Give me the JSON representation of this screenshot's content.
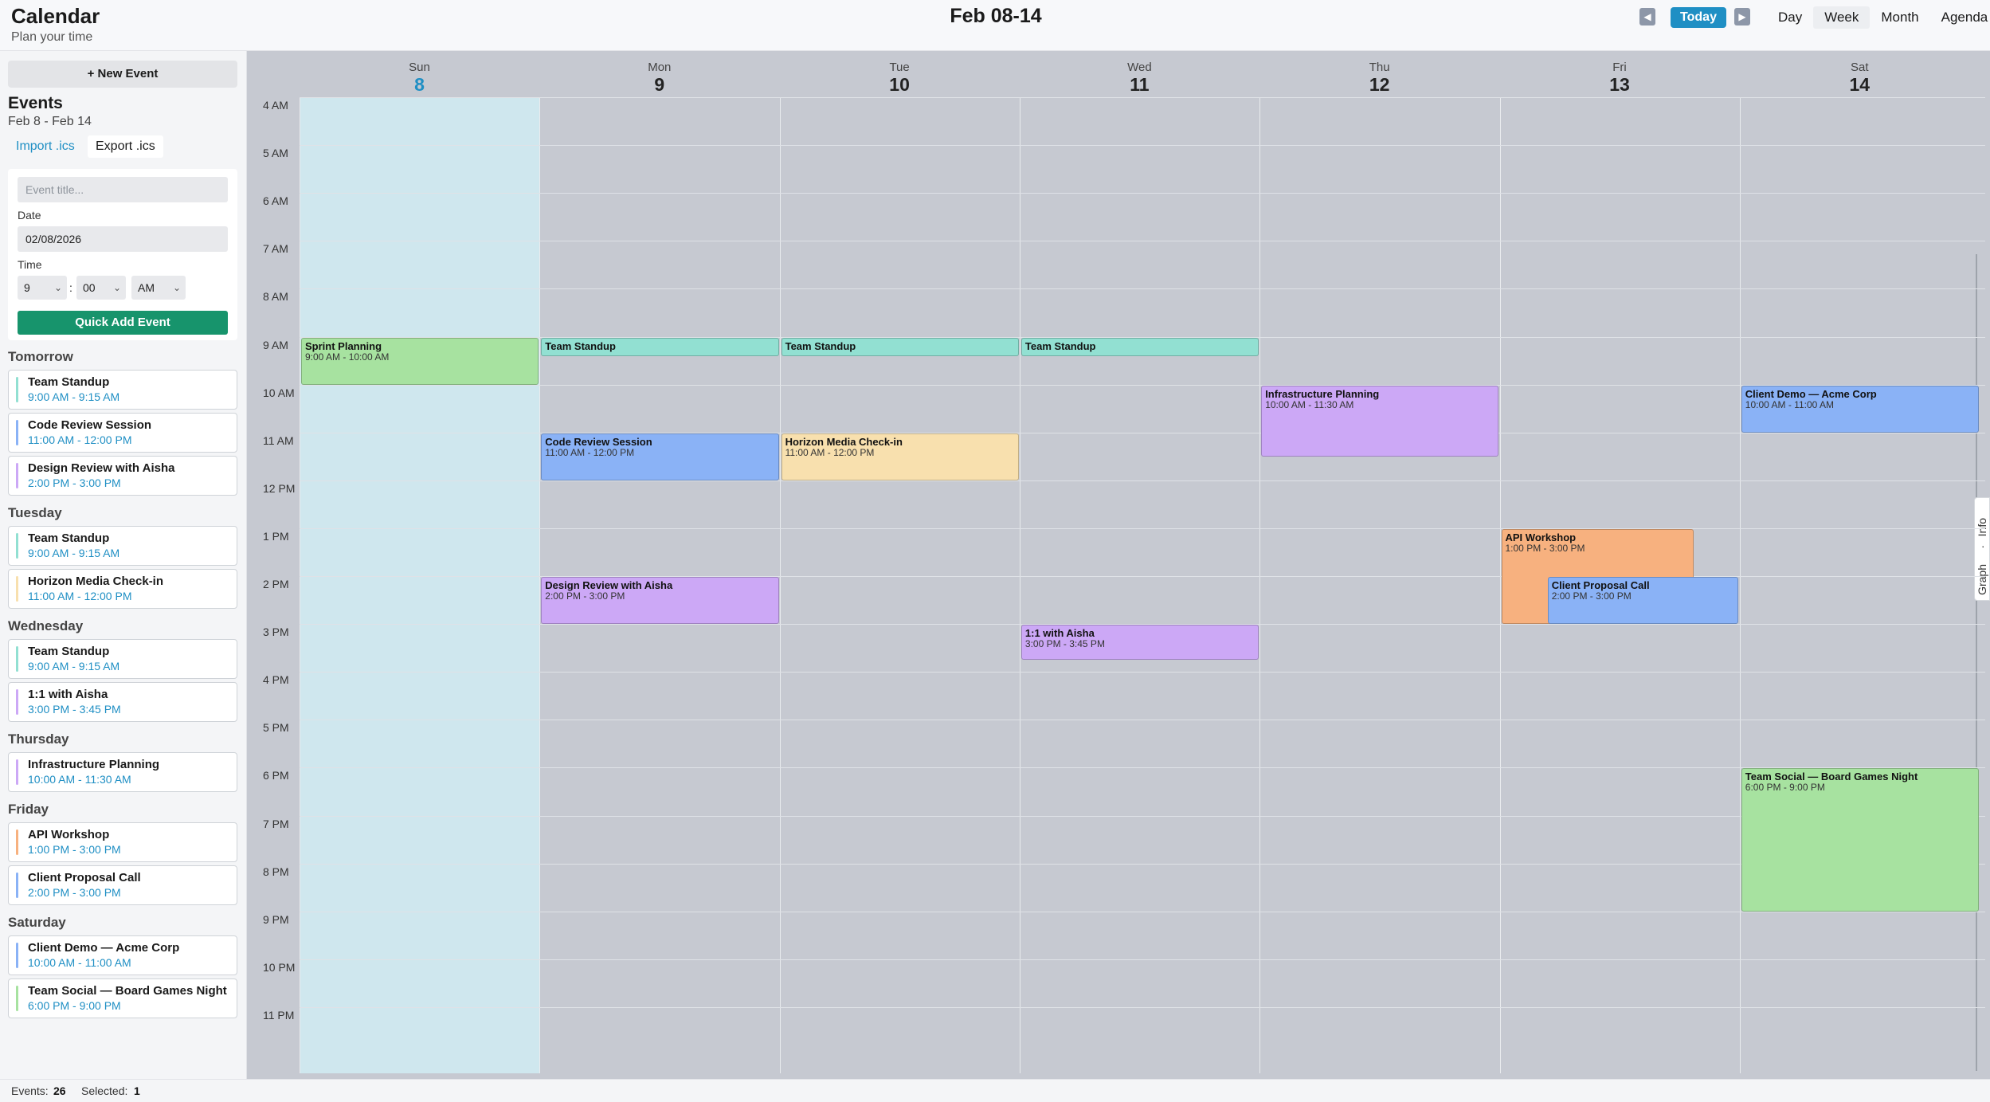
{
  "header": {
    "title": "Calendar",
    "subtitle": "Plan your time",
    "range": "Feb 08-14",
    "today_label": "Today",
    "prev_icon": "prev-arrow-icon",
    "next_icon": "next-arrow-icon",
    "views": [
      "Day",
      "Week",
      "Month",
      "Agenda"
    ],
    "active_view": "Week"
  },
  "sidebar": {
    "new_event": "+ New Event",
    "events_title": "Events",
    "events_range": "Feb 8 - Feb 14",
    "import": "Import .ics",
    "export": "Export .ics",
    "quick_add": {
      "title_placeholder": "Event title...",
      "date_label": "Date",
      "date_value": "02/08/2026",
      "time_label": "Time",
      "hour": "9",
      "minute": "00",
      "ampm": "AM",
      "submit": "Quick Add Event"
    },
    "groups": [
      {
        "day": "Tomorrow",
        "events": [
          {
            "title": "Team Standup",
            "time": "9:00 AM - 9:15 AM",
            "color": "#92e0d2"
          },
          {
            "title": "Code Review Session",
            "time": "11:00 AM - 12:00 PM",
            "color": "#8ab2f6"
          },
          {
            "title": "Design Review with Aisha",
            "time": "2:00 PM - 3:00 PM",
            "color": "#cca8f6"
          }
        ]
      },
      {
        "day": "Tuesday",
        "events": [
          {
            "title": "Team Standup",
            "time": "9:00 AM - 9:15 AM",
            "color": "#92e0d2"
          },
          {
            "title": "Horizon Media Check-in",
            "time": "11:00 AM - 12:00 PM",
            "color": "#f8e0ae"
          }
        ]
      },
      {
        "day": "Wednesday",
        "events": [
          {
            "title": "Team Standup",
            "time": "9:00 AM - 9:15 AM",
            "color": "#92e0d2"
          },
          {
            "title": "1:1 with Aisha",
            "time": "3:00 PM - 3:45 PM",
            "color": "#cca8f6"
          }
        ]
      },
      {
        "day": "Thursday",
        "events": [
          {
            "title": "Infrastructure Planning",
            "time": "10:00 AM - 11:30 AM",
            "color": "#cca8f6"
          }
        ]
      },
      {
        "day": "Friday",
        "events": [
          {
            "title": "API Workshop",
            "time": "1:00 PM - 3:00 PM",
            "color": "#f7b17f"
          },
          {
            "title": "Client Proposal Call",
            "time": "2:00 PM - 3:00 PM",
            "color": "#8ab2f6"
          }
        ]
      },
      {
        "day": "Saturday",
        "events": [
          {
            "title": "Client Demo — Acme Corp",
            "time": "10:00 AM - 11:00 AM",
            "color": "#8ab2f6"
          },
          {
            "title": "Team Social — Board Games Night",
            "time": "6:00 PM - 9:00 PM",
            "color": "#a7e2a0"
          }
        ]
      }
    ]
  },
  "calendar": {
    "days": [
      {
        "name": "Sun",
        "date": "8",
        "today": true
      },
      {
        "name": "Mon",
        "date": "9"
      },
      {
        "name": "Tue",
        "date": "10"
      },
      {
        "name": "Wed",
        "date": "11"
      },
      {
        "name": "Thu",
        "date": "12"
      },
      {
        "name": "Fri",
        "date": "13"
      },
      {
        "name": "Sat",
        "date": "14"
      }
    ],
    "hours": [
      "4 AM",
      "5 AM",
      "6 AM",
      "7 AM",
      "8 AM",
      "9 AM",
      "10 AM",
      "11 AM",
      "12 PM",
      "1 PM",
      "2 PM",
      "3 PM",
      "4 PM",
      "5 PM",
      "6 PM",
      "7 PM",
      "8 PM",
      "9 PM",
      "10 PM",
      "11 PM"
    ],
    "events": [
      {
        "day": 0,
        "title": "Sprint Planning",
        "time": "9:00 AM - 10:00 AM",
        "start": 9,
        "end": 10,
        "color": "green"
      },
      {
        "day": 1,
        "title": "Team Standup",
        "start": 9,
        "end": 9.4,
        "color": "teal"
      },
      {
        "day": 2,
        "title": "Team Standup",
        "start": 9,
        "end": 9.4,
        "color": "teal"
      },
      {
        "day": 3,
        "title": "Team Standup",
        "start": 9,
        "end": 9.4,
        "color": "teal"
      },
      {
        "day": 4,
        "title": "Infrastructure Planning",
        "time": "10:00 AM - 11:30 AM",
        "start": 10,
        "end": 11.5,
        "color": "purple"
      },
      {
        "day": 6,
        "title": "Client Demo — Acme Corp",
        "time": "10:00 AM - 11:00 AM",
        "start": 10,
        "end": 11,
        "color": "blue"
      },
      {
        "day": 1,
        "title": "Code Review Session",
        "time": "11:00 AM - 12:00 PM",
        "start": 11,
        "end": 12,
        "color": "blue"
      },
      {
        "day": 2,
        "title": "Horizon Media Check-in",
        "time": "11:00 AM - 12:00 PM",
        "start": 11,
        "end": 12,
        "color": "yellow"
      },
      {
        "day": 5,
        "title": "API Workshop",
        "time": "1:00 PM - 3:00 PM",
        "start": 13,
        "end": 15,
        "color": "orange",
        "lane": 0
      },
      {
        "day": 5,
        "title": "Client Proposal Call",
        "time": "2:00 PM - 3:00 PM",
        "start": 14,
        "end": 15,
        "color": "blue",
        "lane": 1
      },
      {
        "day": 1,
        "title": "Design Review with Aisha",
        "time": "2:00 PM - 3:00 PM",
        "start": 14,
        "end": 15,
        "color": "purple"
      },
      {
        "day": 3,
        "title": "1:1 with Aisha",
        "time": "3:00 PM - 3:45 PM",
        "start": 15,
        "end": 15.75,
        "color": "purple"
      },
      {
        "day": 6,
        "title": "Team Social — Board Games Night",
        "time": "6:00 PM - 9:00 PM",
        "start": 18,
        "end": 21,
        "color": "green"
      }
    ]
  },
  "side_tabs": {
    "info": "Info",
    "sep": "·",
    "graph": "Graph"
  },
  "footer": {
    "events_label": "Events:",
    "events_count": "26",
    "selected_label": "Selected:",
    "selected_count": "1"
  }
}
